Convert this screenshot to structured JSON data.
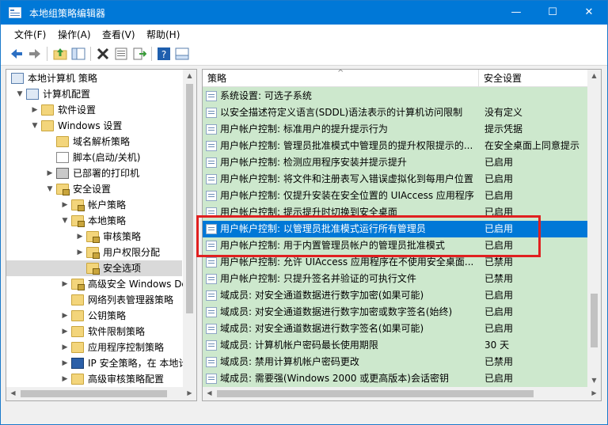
{
  "window": {
    "title": "本地组策略编辑器",
    "accent": "#0078d7",
    "minimize_glyph": "—",
    "maximize_glyph": "☐",
    "close_glyph": "✕"
  },
  "menu": [
    "文件(F)",
    "操作(A)",
    "查看(V)",
    "帮助(H)"
  ],
  "toolbar_icons": [
    "back-icon",
    "forward-icon",
    "up-folder-icon",
    "show-hide-tree-icon",
    "delete-icon",
    "properties-icon",
    "export-icon",
    "help-icon",
    "view-icon"
  ],
  "tree": [
    {
      "label": "本地计算机 策略",
      "depth": 0,
      "arrow": "",
      "icon": "computer-policy-icon"
    },
    {
      "label": "计算机配置",
      "depth": 1,
      "arrow": "▼",
      "icon": "computer-config-icon"
    },
    {
      "label": "软件设置",
      "depth": 2,
      "arrow": "▶",
      "icon": "folder-icon"
    },
    {
      "label": "Windows 设置",
      "depth": 2,
      "arrow": "▼",
      "icon": "folder-icon"
    },
    {
      "label": "域名解析策略",
      "depth": 3,
      "arrow": "",
      "icon": "folder-icon"
    },
    {
      "label": "脚本(启动/关机)",
      "depth": 3,
      "arrow": "",
      "icon": "script-icon"
    },
    {
      "label": "已部署的打印机",
      "depth": 3,
      "arrow": "▶",
      "icon": "printer-icon"
    },
    {
      "label": "安全设置",
      "depth": 3,
      "arrow": "▼",
      "icon": "security-folder-icon"
    },
    {
      "label": "帐户策略",
      "depth": 4,
      "arrow": "▶",
      "icon": "security-folder-icon"
    },
    {
      "label": "本地策略",
      "depth": 4,
      "arrow": "▼",
      "icon": "security-folder-icon"
    },
    {
      "label": "审核策略",
      "depth": 5,
      "arrow": "▶",
      "icon": "security-folder-icon"
    },
    {
      "label": "用户权限分配",
      "depth": 5,
      "arrow": "▶",
      "icon": "security-folder-icon"
    },
    {
      "label": "安全选项",
      "depth": 5,
      "arrow": "",
      "icon": "security-folder-icon"
    },
    {
      "label": "高级安全 Windows De",
      "depth": 4,
      "arrow": "▶",
      "icon": "firewall-folder-icon"
    },
    {
      "label": "网络列表管理器策略",
      "depth": 4,
      "arrow": "",
      "icon": "folder-icon"
    },
    {
      "label": "公钥策略",
      "depth": 4,
      "arrow": "▶",
      "icon": "folder-icon"
    },
    {
      "label": "软件限制策略",
      "depth": 4,
      "arrow": "▶",
      "icon": "folder-icon"
    },
    {
      "label": "应用程序控制策略",
      "depth": 4,
      "arrow": "▶",
      "icon": "folder-icon"
    },
    {
      "label": "IP 安全策略，在 本地计",
      "depth": 4,
      "arrow": "▶",
      "icon": "ip-security-icon"
    },
    {
      "label": "高级审核策略配置",
      "depth": 4,
      "arrow": "▶",
      "icon": "folder-icon"
    }
  ],
  "columns": {
    "policy": "策略",
    "setting": "安全设置"
  },
  "sort_glyph": "^",
  "rows": [
    {
      "policy": "系统设置: 可选子系统",
      "setting": ""
    },
    {
      "policy": "以安全描述符定义语言(SDDL)语法表示的计算机访问限制",
      "setting": "没有定义"
    },
    {
      "policy": "用户帐户控制: 标准用户的提升提示行为",
      "setting": "提示凭据"
    },
    {
      "policy": "用户帐户控制: 管理员批准模式中管理员的提升权限提示的...",
      "setting": "在安全桌面上同意提示"
    },
    {
      "policy": "用户帐户控制: 检测应用程序安装并提示提升",
      "setting": "已启用"
    },
    {
      "policy": "用户帐户控制: 将文件和注册表写入错误虚拟化到每用户位置",
      "setting": "已启用"
    },
    {
      "policy": "用户帐户控制: 仅提升安装在安全位置的 UIAccess 应用程序",
      "setting": "已启用"
    },
    {
      "policy": "用户帐户控制: 提示提升时切换到安全桌面",
      "setting": "已启用"
    },
    {
      "policy": "用户帐户控制: 以管理员批准模式运行所有管理员",
      "setting": "已启用"
    },
    {
      "policy": "用户帐户控制: 用于内置管理员帐户的管理员批准模式",
      "setting": "已启用"
    },
    {
      "policy": "用户帐户控制: 允许 UIAccess 应用程序在不使用安全桌面...",
      "setting": "已禁用"
    },
    {
      "policy": "用户帐户控制: 只提升签名并验证的可执行文件",
      "setting": "已禁用"
    },
    {
      "policy": "域成员: 对安全通道数据进行数字加密(如果可能)",
      "setting": "已启用"
    },
    {
      "policy": "域成员: 对安全通道数据进行数字加密或数字签名(始终)",
      "setting": "已启用"
    },
    {
      "policy": "域成员: 对安全通道数据进行数字签名(如果可能)",
      "setting": "已启用"
    },
    {
      "policy": "域成员: 计算机帐户密码最长使用期限",
      "setting": "30 天"
    },
    {
      "policy": "域成员: 禁用计算机帐户密码更改",
      "setting": "已禁用"
    },
    {
      "policy": "域成员: 需要强(Windows 2000 或更高版本)会话密钥",
      "setting": "已启用"
    }
  ]
}
